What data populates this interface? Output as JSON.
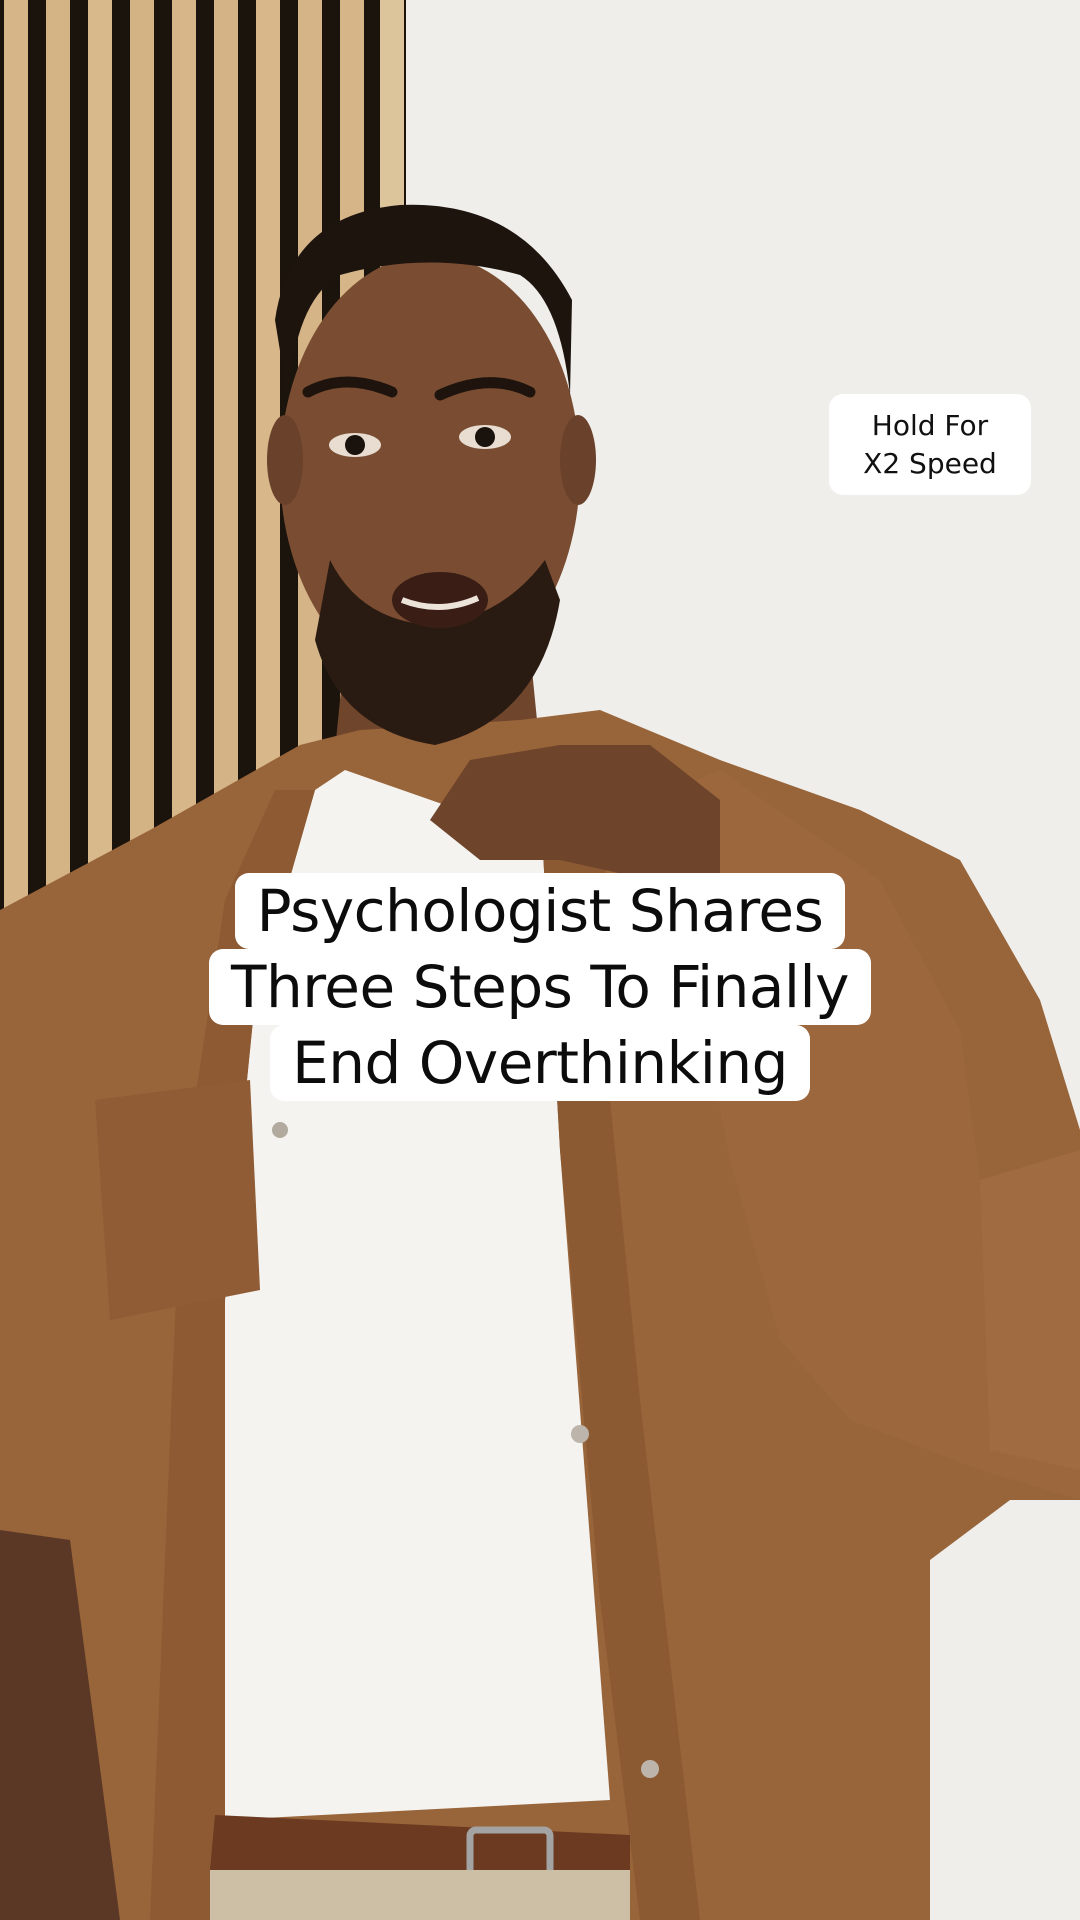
{
  "hold_badge": {
    "line1": "Hold For",
    "line2": "X2 Speed"
  },
  "caption": {
    "line1": "Psychologist Shares",
    "line2": "Three Steps To Finally",
    "line3": "End Overthinking"
  },
  "colors": {
    "wall": "#eceae6",
    "slat_wood": "#d6b688",
    "slat_gap": "#1b140d",
    "jacket": "#98643a",
    "shirt": "#f4f3ef",
    "skin": "#7a4d32",
    "hair": "#1e140e",
    "belt": "#6b3a20"
  }
}
